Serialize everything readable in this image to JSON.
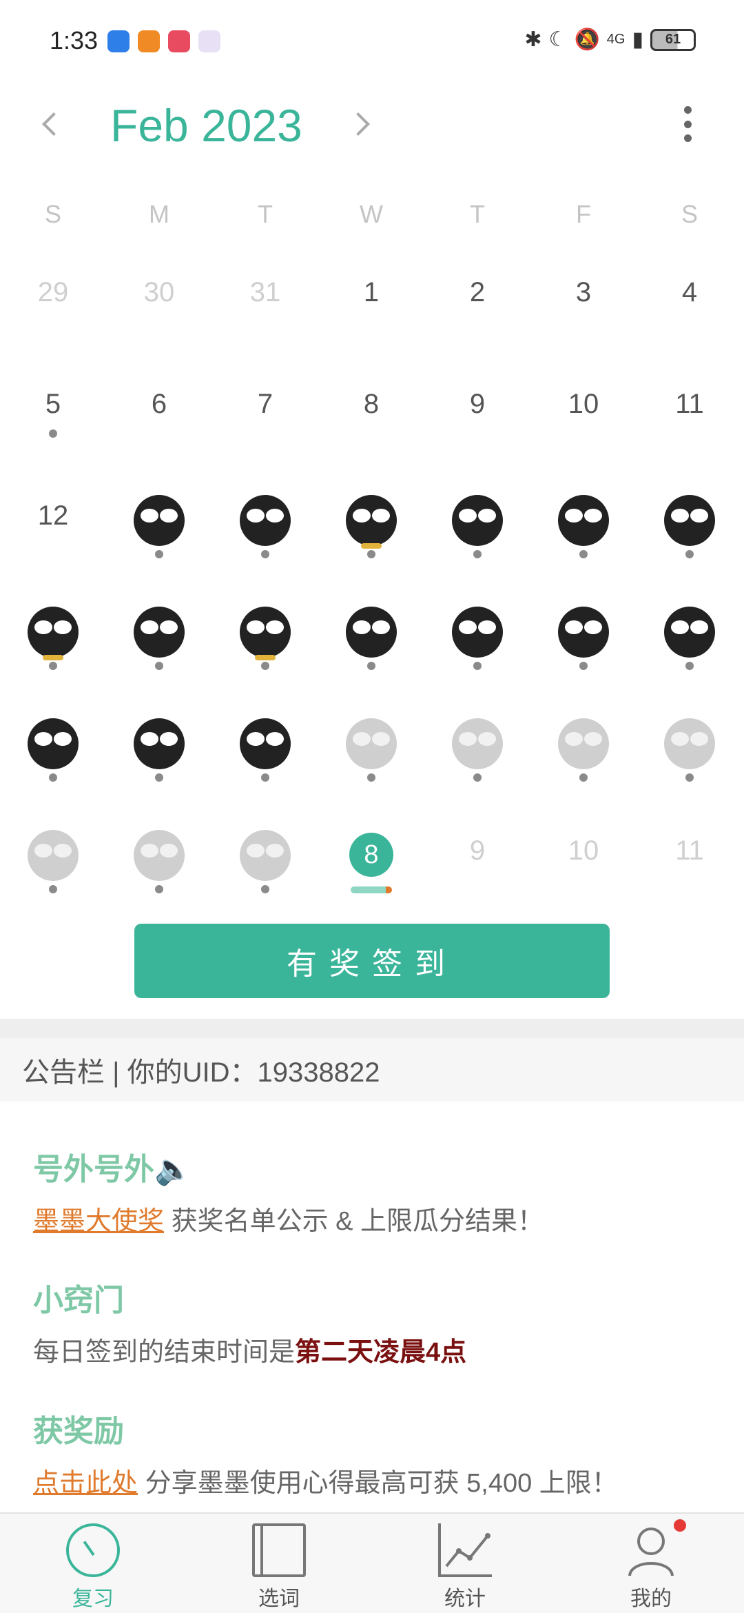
{
  "status": {
    "time": "1:33",
    "battery": "61",
    "network": "4G"
  },
  "header": {
    "month_title": "Feb 2023"
  },
  "weekdays": [
    "S",
    "M",
    "T",
    "W",
    "T",
    "F",
    "S"
  ],
  "calendar": {
    "row1": [
      "29",
      "30",
      "31",
      "1",
      "2",
      "3",
      "4"
    ],
    "row2": [
      "5",
      "6",
      "7",
      "8",
      "9",
      "10",
      "11"
    ],
    "row3_first": "12",
    "row6_rest": [
      "9",
      "10",
      "11"
    ],
    "today": "8"
  },
  "checkin_button": "有奖签到",
  "notice": {
    "bar_text": "公告栏 | 你的UID：19338822",
    "section1_title": "号外号外🔈",
    "section1_link": "墨墨大使奖",
    "section1_text": " 获奖名单公示 & 上限瓜分结果！",
    "section2_title": "小窍门",
    "section2_text": "每日签到的结束时间是",
    "section2_strong": "第二天凌晨4点",
    "section3_title": "获奖励",
    "section3_link": "点击此处",
    "section3_text": " 分享墨墨使用心得最高可获 5,400 上限！"
  },
  "bottom_nav": {
    "review": "复习",
    "words": "选词",
    "stats": "统计",
    "me": "我的"
  },
  "colors": {
    "accent": "#3bb59a",
    "link": "#e07a2c",
    "strong": "#7a1010"
  }
}
